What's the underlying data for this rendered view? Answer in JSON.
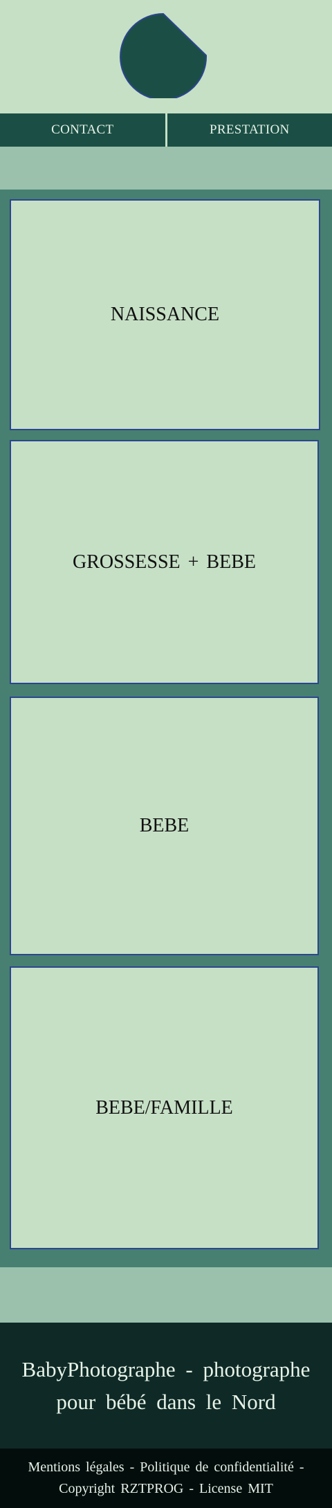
{
  "brand": {
    "logo_icon": "logo-icon",
    "logo_color": "#1b4f45"
  },
  "nav": {
    "items": [
      {
        "label": "CONTACT"
      },
      {
        "label": "PRESTATION"
      }
    ]
  },
  "categories": [
    {
      "label": "NAISSANCE"
    },
    {
      "label": "GROSSESSE + BEBE"
    },
    {
      "label": "BEBE"
    },
    {
      "label": "BEBE/FAMILLE"
    }
  ],
  "footer": {
    "title": "BabyPhotographe - photographe pour bébé dans le Nord"
  },
  "legal": {
    "mentions": "Mentions légales",
    "separator": "-",
    "privacy": "Politique de confidentialité",
    "copyright": "Copyright RZTPROG",
    "license": "License MIT"
  },
  "colors": {
    "background": "#c6e0c5",
    "nav": "#1b4f45",
    "main": "#478070",
    "band": "#9bc1ad",
    "footer": "#0f2a26",
    "legal": "#030e0c",
    "card_border": "#2b4590"
  }
}
